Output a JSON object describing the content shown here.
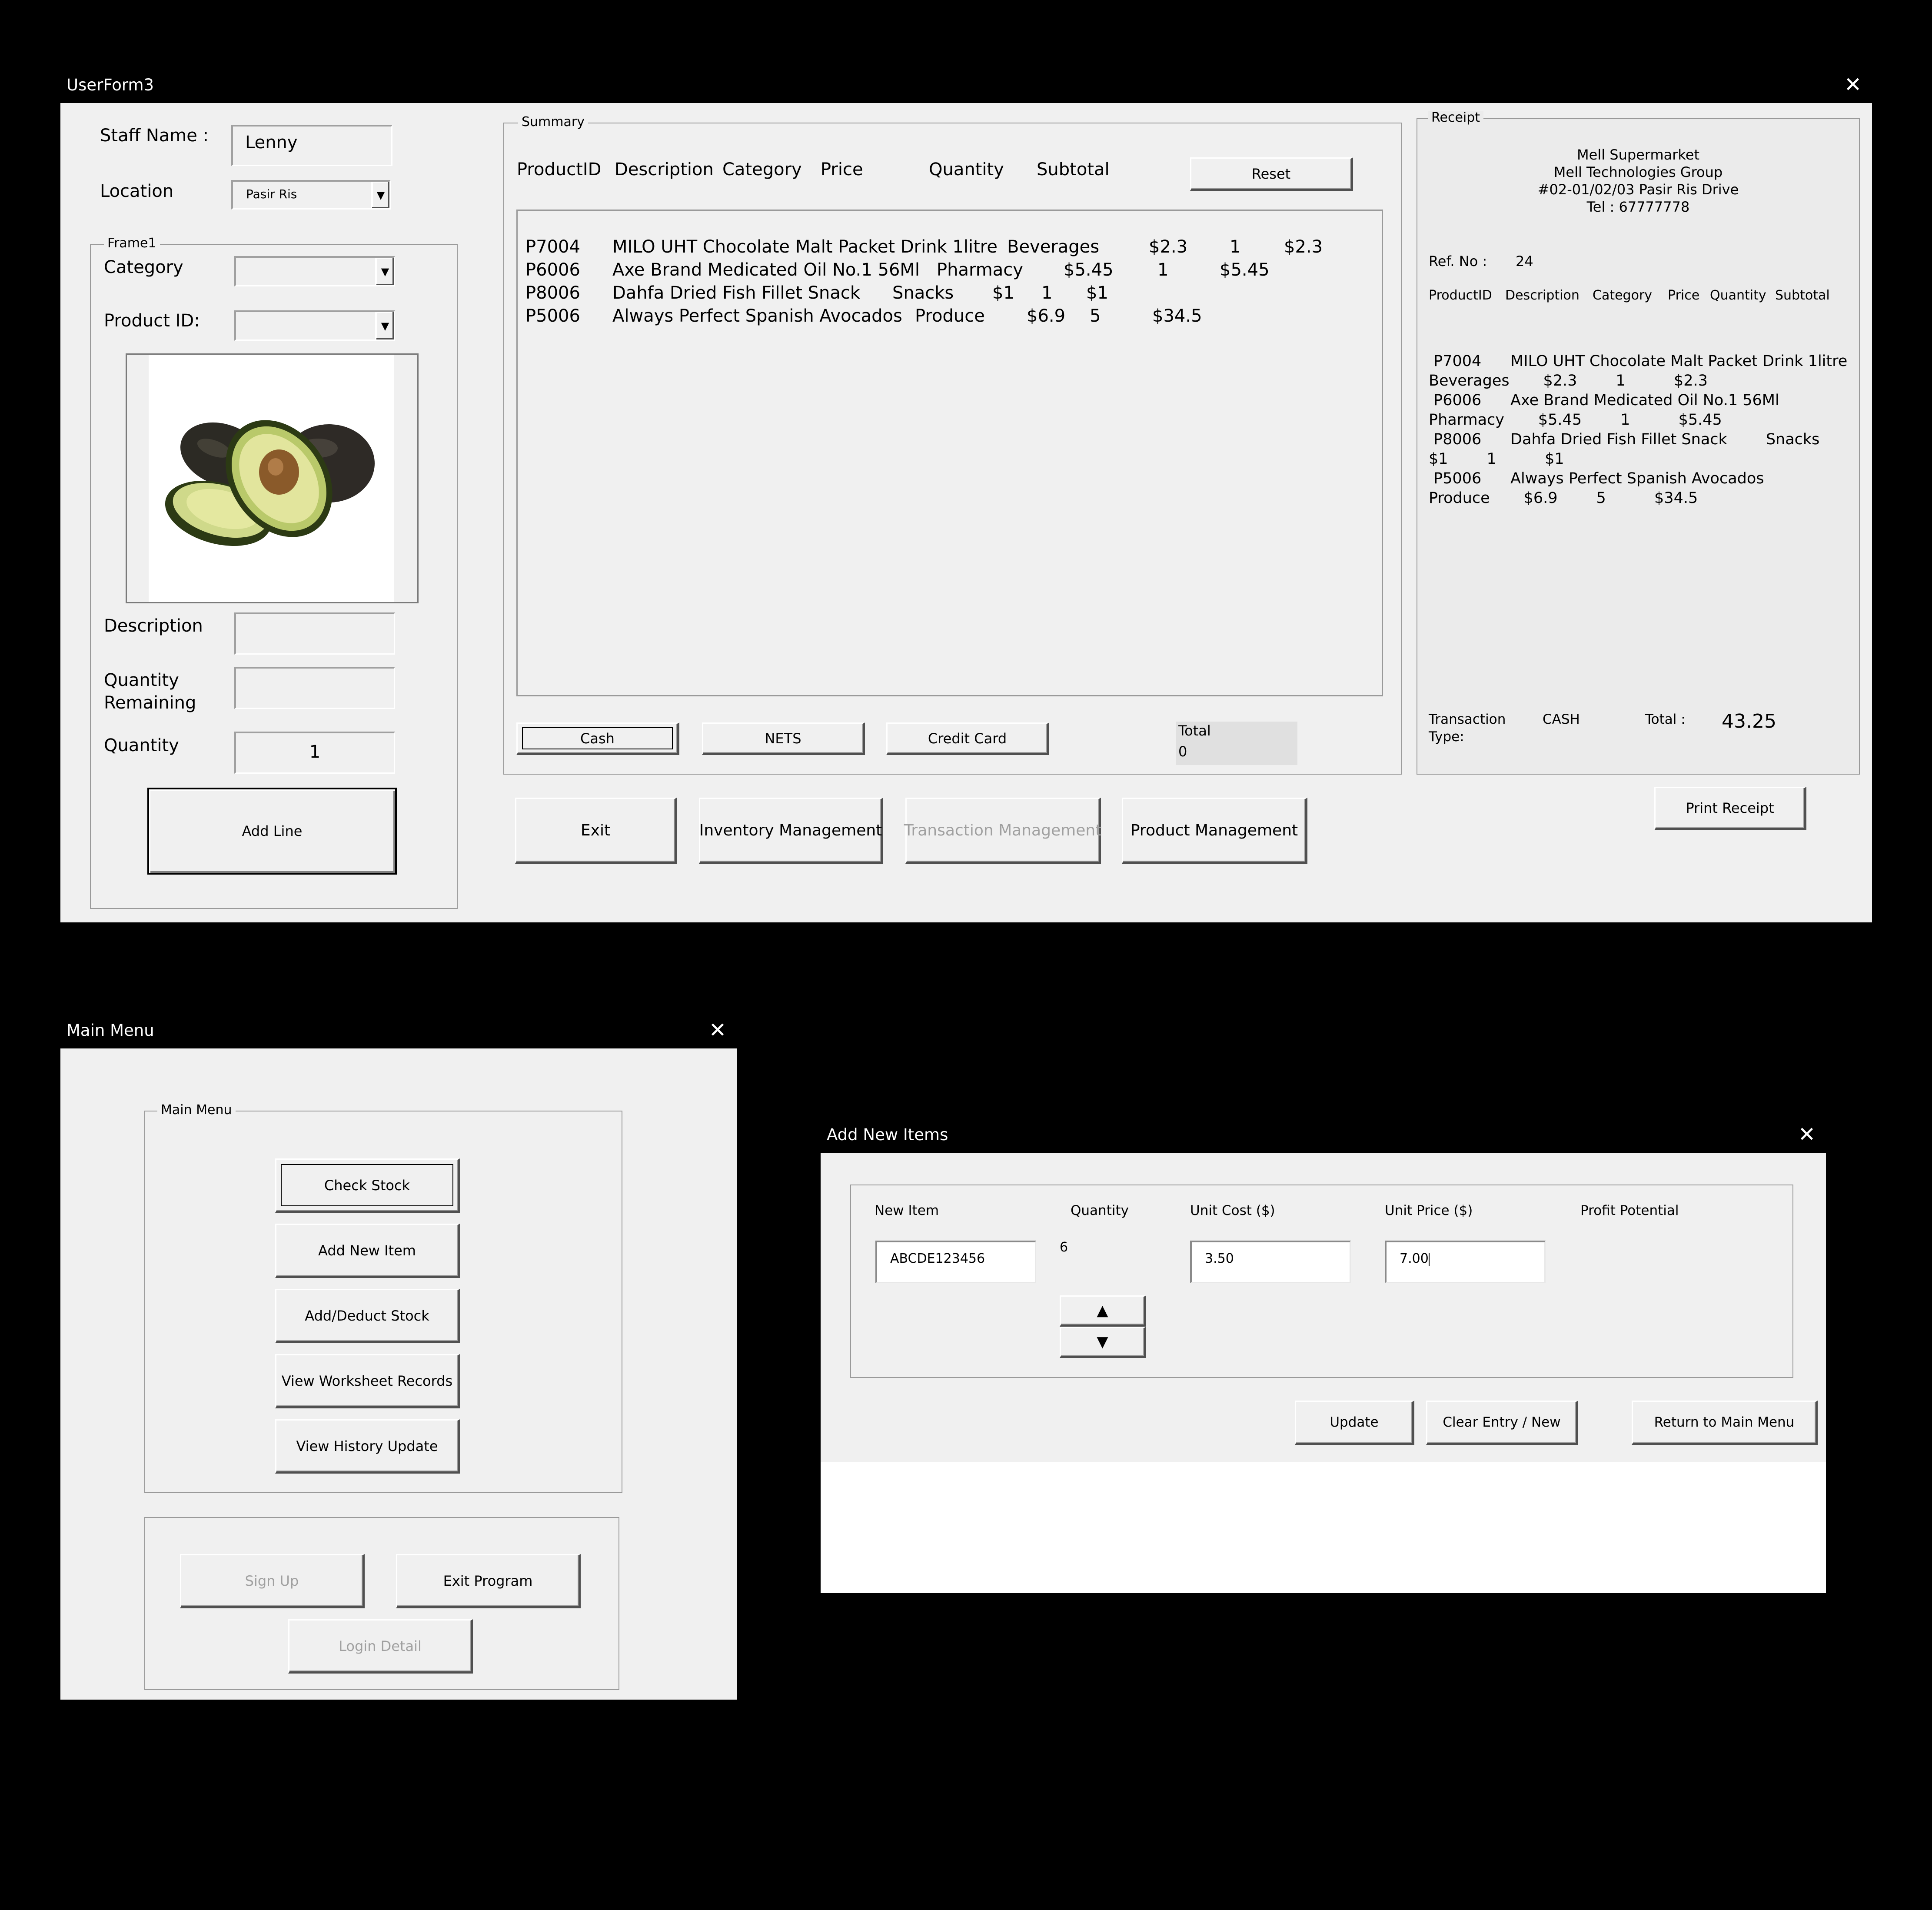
{
  "userform3": {
    "title": "UserForm3",
    "staff_name_label": "Staff Name :",
    "staff_name_value": "Lenny",
    "location_label": "Location",
    "location_value": "Pasir Ris",
    "frame1_caption": "Frame1",
    "category_label": "Category",
    "category_value": "",
    "product_id_label": "Product ID:",
    "product_id_value": "",
    "product_image": "avocado-image",
    "description_label": "Description",
    "description_value": "",
    "qty_remaining_label_1": "Quantity",
    "qty_remaining_label_2": "Remaining",
    "qty_remaining_value": "",
    "quantity_label": "Quantity",
    "quantity_value": "1",
    "add_line_label": "Add Line",
    "summary": {
      "caption": "Summary",
      "headers": [
        "ProductID",
        "Description",
        "Category",
        "Price",
        "Quantity",
        "Subtotal"
      ],
      "reset_label": "Reset",
      "rows": [
        {
          "id": "P7004",
          "desc": "MILO UHT Chocolate Malt Packet Drink 1litre",
          "cat": "Beverages",
          "price": "$2.3",
          "qty": "1",
          "subtotal": "$2.3"
        },
        {
          "id": "P6006",
          "desc": "Axe Brand Medicated Oil No.1 56Ml",
          "cat": "Pharmacy",
          "price": "$5.45",
          "qty": "1",
          "subtotal": "$5.45"
        },
        {
          "id": "P8006",
          "desc": "Dahfa Dried Fish Fillet Snack",
          "cat": "Snacks",
          "price": "$1",
          "qty": "1",
          "subtotal": "$1"
        },
        {
          "id": "P5006",
          "desc": "Always Perfect Spanish Avocados",
          "cat": "Produce",
          "price": "$6.9",
          "qty": "5",
          "subtotal": "$34.5"
        }
      ],
      "cash_label": "Cash",
      "nets_label": "NETS",
      "credit_label": "Credit Card",
      "total_label": "Total",
      "total_value": "0"
    },
    "receipt": {
      "caption": "Receipt",
      "store_name": "Mell Supermarket",
      "company": "Mell Technologies Group",
      "address": "#02-01/02/03 Pasir Ris Drive",
      "tel": "Tel : 67777778",
      "ref_label": "Ref. No :",
      "ref_value": "24",
      "headers": [
        "ProductID",
        "Description",
        "Category",
        "Price",
        "Quantity",
        "Subtotal"
      ],
      "lines": [
        " P7004      MILO UHT Chocolate Malt Packet Drink 1litre",
        "Beverages       $2.3        1          $2.3",
        " P6006      Axe Brand Medicated Oil No.1 56Ml",
        "Pharmacy       $5.45        1          $5.45",
        " P8006      Dahfa Dried Fish Fillet Snack        Snacks",
        "$1        1          $1",
        " P5006      Always Perfect Spanish Avocados",
        "Produce       $6.9        5          $34.5"
      ],
      "transaction_label_1": "Transaction",
      "transaction_label_2": "Type:",
      "transaction_value": "CASH",
      "total_label": "Total :",
      "total_value": "43.25"
    },
    "print_receipt_label": "Print Receipt",
    "exit_label": "Exit",
    "inventory_label": "Inventory Management",
    "transaction_mgmt_label": "Transaction Management",
    "product_mgmt_label": "Product  Management"
  },
  "main_menu": {
    "title": "Main Menu",
    "frame_caption": "Main Menu",
    "check_stock_label": "Check Stock",
    "add_new_item_label": "Add New Item",
    "add_deduct_label": "Add/Deduct Stock",
    "view_records_label": "View Worksheet Records",
    "view_history_label": "View History Update",
    "sign_up_label": "Sign Up",
    "exit_program_label": "Exit Program",
    "login_detail_label": "Login Detail"
  },
  "add_new_items": {
    "title": "Add New Items",
    "new_item_label": "New Item",
    "quantity_label": "Quantity",
    "unit_cost_label": "Unit Cost ($)",
    "unit_price_label": "Unit Price ($)",
    "profit_label": "Profit Potential",
    "new_item_value": "ABCDE123456",
    "quantity_value": "6",
    "unit_cost_value": "3.50",
    "unit_price_value": "7.00",
    "update_label": "Update",
    "clear_label": "Clear Entry / New",
    "return_label": "Return to Main Menu"
  },
  "colors": {
    "form_bg": "#f0f0f0",
    "titlebar_bg": "#000000",
    "disabled_text": "#a0a0a0"
  }
}
